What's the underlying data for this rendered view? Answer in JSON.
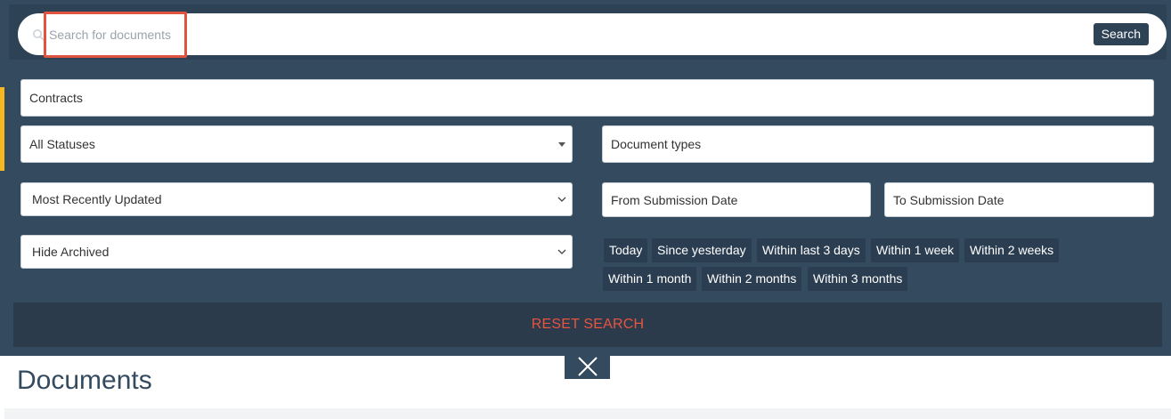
{
  "search": {
    "placeholder": "Search for documents",
    "value": "",
    "button_label": "Search"
  },
  "filters": {
    "contracts": "Contracts",
    "status": "All Statuses",
    "document_types": "Document types",
    "sort": "Most Recently Updated",
    "from_date": "From Submission Date",
    "to_date": "To Submission Date",
    "archived": "Hide Archived"
  },
  "quick_dates": [
    "Today",
    "Since yesterday",
    "Within last 3 days",
    "Within 1 week",
    "Within 2 weeks",
    "Within 1 month",
    "Within 2 months",
    "Within 3 months"
  ],
  "reset_label": "RESET SEARCH",
  "page_title": "Documents",
  "icons": {
    "search": "search-icon",
    "close": "close-icon",
    "dropdown": "caret-down-icon",
    "chevron": "chevron-down-icon"
  },
  "colors": {
    "panel": "#344a5f",
    "accent": "#f5b81f",
    "reset": "#e8543f",
    "highlight": "#e0533f"
  }
}
